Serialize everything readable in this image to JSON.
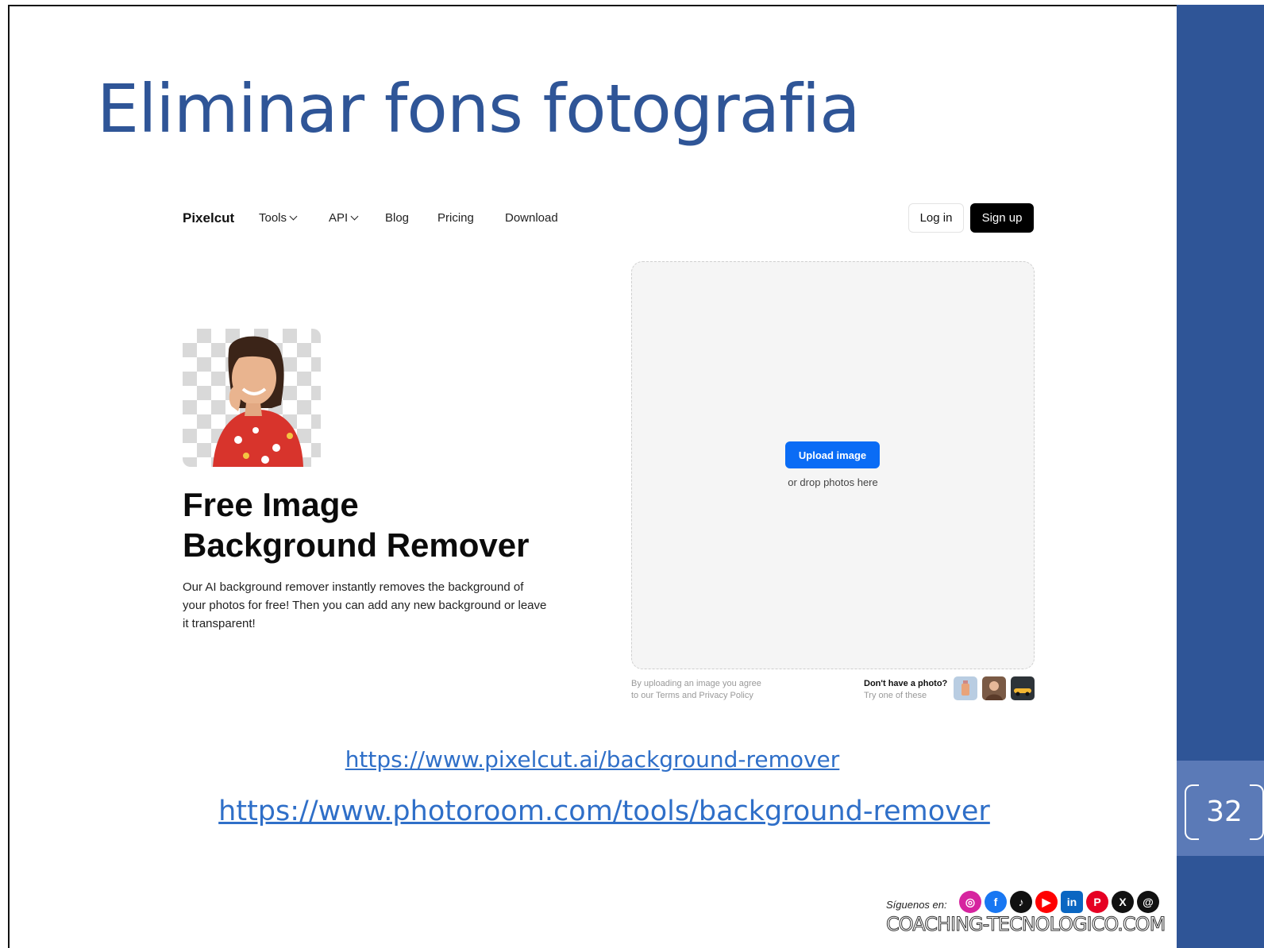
{
  "slide": {
    "title": "Eliminar fons fotografia",
    "page_number": "32",
    "links": [
      "https://www.pixelcut.ai/background-remover",
      "https://www.photoroom.com/tools/background-remover"
    ],
    "footer": {
      "follow_text": "Síguenos en:",
      "site": "COACHING-TECNOLOGICO.COM",
      "social_icons": [
        "instagram-icon",
        "facebook-icon",
        "tiktok-icon",
        "youtube-icon",
        "linkedin-icon",
        "pinterest-icon",
        "x-icon",
        "threads-icon"
      ]
    },
    "colors": {
      "accent": "#2f5597",
      "link": "#2f6fc8"
    }
  },
  "pixelcut": {
    "logo": "Pixelcut",
    "nav": [
      "Tools",
      "API",
      "Blog",
      "Pricing",
      "Download"
    ],
    "login": "Log in",
    "signup": "Sign up",
    "hero_title_line1": "Free Image",
    "hero_title_line2": "Background Remover",
    "hero_desc": "Our AI background remover instantly removes the background of your photos for free! Then you can add any new background or leave it transparent!",
    "upload_button": "Upload image",
    "drop_text": "or drop photos here",
    "agree_line1": "By uploading an image you agree",
    "agree_line2": "to our Terms and Privacy Policy",
    "no_photo_q": "Don't have a photo?",
    "no_photo_t": "Try one of these",
    "upload_color": "#0a6cf5"
  }
}
